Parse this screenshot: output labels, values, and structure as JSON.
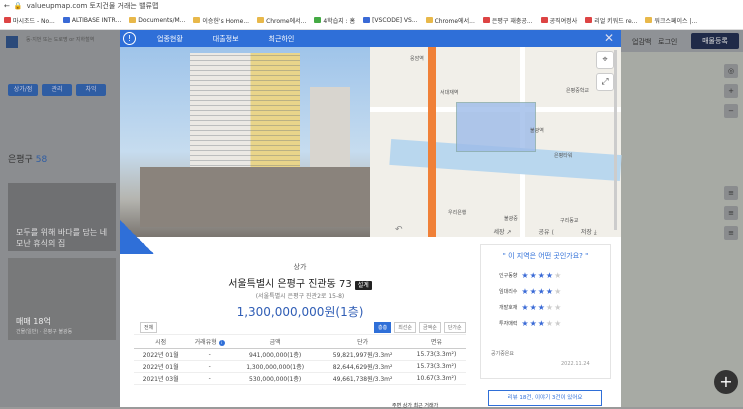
{
  "browser": {
    "url": "valueupmap.com 토지건물 거래는 밸류맵",
    "bookmarks": [
      "마시조드 - No...",
      "ALTIBASE INTR...",
      "Documents/M...",
      "이승헌's Home...",
      "Chrome에서...",
      "4학습지 : 홈",
      "[VSCODE] VS...",
      "Chrome에서...",
      "은평구 재충공...",
      "공직여정사",
      "리얼 키워드 re...",
      "워크스페이스 |...",
      "모바일 북마크"
    ]
  },
  "background": {
    "search_placeholder": "동·지번 또는 도로명 or 지하철역",
    "region": "은평구",
    "region_count": "58",
    "card1_text": "모두를 위해 바다를 담는 네모난 휴식의 집",
    "card2_title": "매매 18억",
    "card2_sub": "건물(일반) · 은평구 불광동",
    "filter_labels": [
      "상가/점",
      "관리",
      "차익"
    ],
    "right_links": [
      "업감백",
      "로그인"
    ],
    "sale_button": "매물등록"
  },
  "modal": {
    "tabs": [
      "업종현황",
      "대출정보",
      "최근하인"
    ],
    "map_labels": [
      "서대재역",
      "응암역",
      "불광역",
      "은평타워",
      "우리은행",
      "불광중",
      "은평중학교",
      "구리동교"
    ],
    "category": "상가",
    "address": "서울특별시 은평구 진관동 73",
    "sale_badge": "설계",
    "road_address": "(서울특별시 은평구 진관2로 15-8)",
    "price": "1,300,000,000원(1층)",
    "history_button": "전체",
    "filters": [
      "층층",
      "최선순",
      "금액순",
      "단가순"
    ],
    "table_headers": [
      "시점",
      "거래유형",
      "금액",
      "단가",
      "면유"
    ],
    "rows": [
      [
        "2022년 01월",
        "-",
        "941,000,000(1층)",
        "59,821,997원/3.3m²",
        "15.73(3.3m²)"
      ],
      [
        "2022년 01월",
        "-",
        "1,300,000,000(1층)",
        "82,644,629원/3.3m²",
        "15.73(3.3m²)"
      ],
      [
        "2021년 03월",
        "-",
        "530,000,000(1층)",
        "49,661,738원/3.3m²",
        "10.67(3.3m²)"
      ]
    ],
    "actions": [
      "세장",
      "공유",
      "저장"
    ],
    "question": "\" 이 지역은 어떤 곳인가요? \"",
    "ratings": [
      {
        "label": "인구동향",
        "stars": 4
      },
      {
        "label": "임대리수",
        "stars": 4
      },
      {
        "label": "개발호재",
        "stars": 3
      },
      {
        "label": "투자매력",
        "stars": 3
      }
    ],
    "source": "공기중은요",
    "date": "2022.11.24",
    "review_button": "리뷰 18건, 이야기 3건이 있어요",
    "more_text": "주변 상가 최근 거래가"
  }
}
